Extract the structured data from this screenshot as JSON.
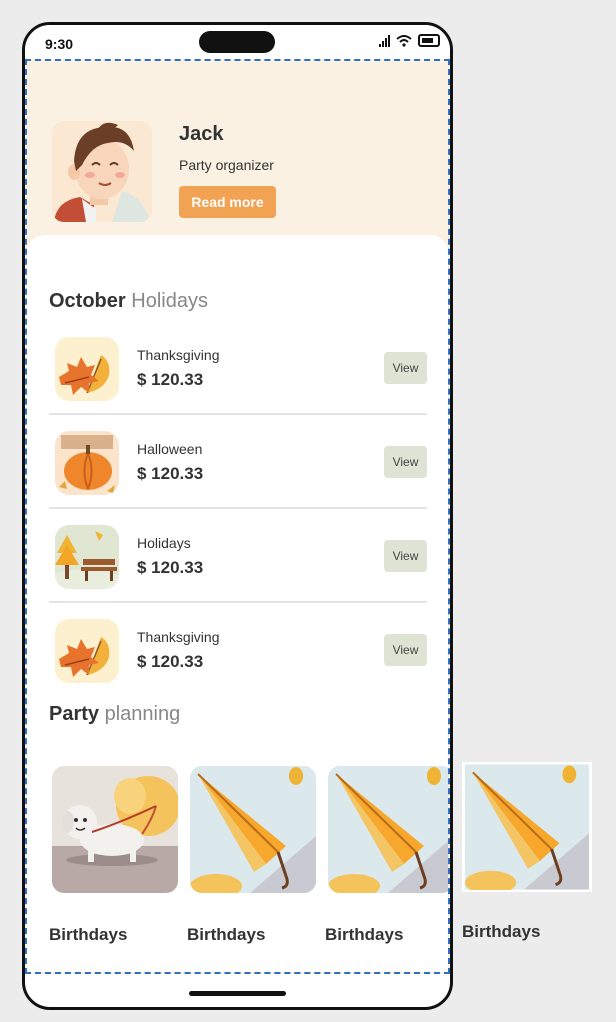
{
  "status_bar": {
    "time": "9:30",
    "icons": [
      "signal-icon",
      "wifi-icon",
      "battery-icon"
    ]
  },
  "profile": {
    "name": "Jack",
    "role": "Party organizer",
    "read_more_label": "Read more",
    "avatar": "avatar-illustration"
  },
  "holidays_section": {
    "title_strong": "October",
    "title_light": "Holidays"
  },
  "holidays": [
    {
      "name": "Thanksgiving",
      "price": "$ 120.33",
      "view_label": "View",
      "icon": "autumn-leaves-icon"
    },
    {
      "name": "Halloween",
      "price": "$ 120.33",
      "view_label": "View",
      "icon": "pumpkin-icon"
    },
    {
      "name": "Holidays",
      "price": "$ 120.33",
      "view_label": "View",
      "icon": "park-bench-icon"
    },
    {
      "name": "Thanksgiving",
      "price": "$ 120.33",
      "view_label": "View",
      "icon": "autumn-leaves-icon"
    }
  ],
  "party_section": {
    "title_strong": "Party",
    "title_light": "planning"
  },
  "party_items": [
    {
      "label": "Birthdays",
      "image": "dog-walk-illustration"
    },
    {
      "label": "Birthdays",
      "image": "umbrella-illustration"
    },
    {
      "label": "Birthdays",
      "image": "umbrella-illustration"
    },
    {
      "label": "Birthdays",
      "image": "umbrella-illustration"
    }
  ],
  "colors": {
    "header_bg": "#faf1e2",
    "accent": "#f2a253",
    "view_button_bg": "#dfe3d3",
    "screen_border": "#2d6fc2"
  }
}
